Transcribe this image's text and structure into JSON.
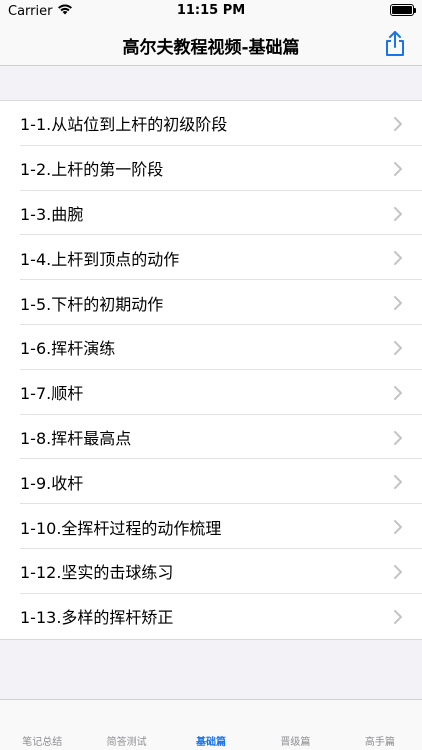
{
  "status_bar": {
    "carrier": "Carrier",
    "time": "11:15 PM"
  },
  "nav": {
    "title": "高尔夫教程视频-基础篇",
    "share_icon": "share-icon"
  },
  "colors": {
    "accent": "#1a73e8",
    "tab_inactive": "#8e8e93",
    "chevron": "#c4c4c7"
  },
  "lessons": [
    {
      "label": "1-1.从站位到上杆的初级阶段"
    },
    {
      "label": "1-2.上杆的第一阶段"
    },
    {
      "label": "1-3.曲腕"
    },
    {
      "label": "1-4.上杆到顶点的动作"
    },
    {
      "label": "1-5.下杆的初期动作"
    },
    {
      "label": "1-6.挥杆演练"
    },
    {
      "label": "1-7.顺杆"
    },
    {
      "label": "1-8.挥杆最高点"
    },
    {
      "label": "1-9.收杆"
    },
    {
      "label": "1-10.全挥杆过程的动作梳理"
    },
    {
      "label": "1-12.坚实的击球练习"
    },
    {
      "label": "1-13.多样的挥杆矫正"
    }
  ],
  "tabs": [
    {
      "label": "笔记总结",
      "active": false
    },
    {
      "label": "简答测试",
      "active": false
    },
    {
      "label": "基础篇",
      "active": true
    },
    {
      "label": "晋级篇",
      "active": false
    },
    {
      "label": "高手篇",
      "active": false
    }
  ]
}
